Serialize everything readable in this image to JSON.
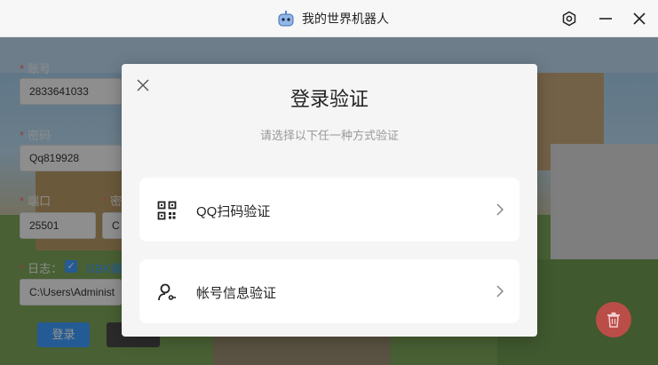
{
  "window": {
    "title": "我的世界机器人"
  },
  "form": {
    "account_label": "账号",
    "account_value": "2833641033",
    "password_label": "密码",
    "password_value": "Qq819928",
    "port_label": "端口",
    "port_value": "25501",
    "second_label_fragment": "密",
    "second_value_fragment": "C",
    "log_label": "日志：",
    "log_link": "GBK编",
    "path_value": "C:\\Users\\Administ",
    "login_button": "登录"
  },
  "modal": {
    "title": "登录验证",
    "subtitle": "请选择以下任一种方式验证",
    "options": [
      {
        "label": "QQ扫码验证",
        "icon": "qr-code-icon"
      },
      {
        "label": "帐号信息验证",
        "icon": "user-key-icon"
      }
    ]
  },
  "colors": {
    "primary": "#409eff",
    "danger": "#e05252",
    "modal_bg": "#f5f5f5"
  }
}
